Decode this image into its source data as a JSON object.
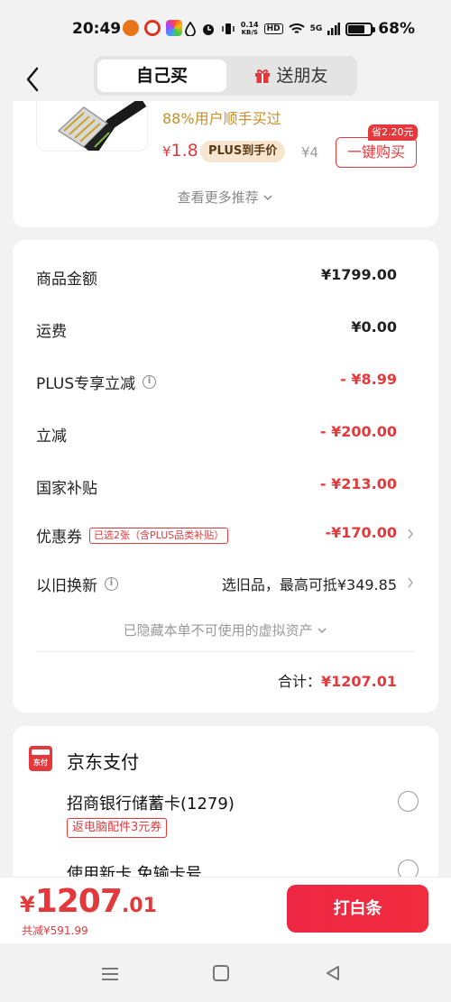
{
  "status_bar": {
    "time": "20:49",
    "net_speed_value": "0.14",
    "net_speed_unit": "KB/S",
    "hd": "HD",
    "signal": "5G",
    "battery_text": "68%",
    "battery_level": 0.68
  },
  "header": {
    "tab_self": "自己买",
    "tab_gift": "送朋友"
  },
  "recommend": {
    "tagline": "88%用户顺手买过",
    "price_symbol": "¥",
    "price": "1.8",
    "plus_label": "PLUS到手价",
    "original_price": "¥4",
    "save_tag": "省2.20元",
    "buy_button": "一键购买",
    "more_label": "查看更多推荐"
  },
  "summary": {
    "rows": [
      {
        "label": "商品金额",
        "value": "¥1799.00"
      },
      {
        "label": "运费",
        "value": "¥0.00"
      },
      {
        "label": "PLUS专享立减",
        "value": "- ¥8.99"
      },
      {
        "label": "立减",
        "value": "- ¥200.00"
      },
      {
        "label": "国家补贴",
        "value": "- ¥213.00"
      },
      {
        "label": "优惠券",
        "tag": "已选2张（含PLUS品类补贴）",
        "value": "-¥170.00"
      },
      {
        "label": "以旧换新",
        "value": "选旧品，最高可抵¥349.85"
      }
    ],
    "hidden_assets": "已隐藏本单不可使用的虚拟资产",
    "total_label": "合计：",
    "total_value": "¥1207.01"
  },
  "payment": {
    "icon_text": "东付",
    "title": "京东支付",
    "options": [
      {
        "label": "招商银行储蓄卡(1279)",
        "promo": "返电脑配件3元券"
      },
      {
        "label": "使用新卡 免输卡号"
      }
    ]
  },
  "bottom": {
    "price_symbol": "¥",
    "price_int": "1207",
    "price_dec": ".01",
    "saved": "共减¥591.99",
    "pay_button": "打白条"
  },
  "colors": {
    "accent": "#e4393c",
    "gold": "#c8902a",
    "plus_bg": "#f6e6cf"
  }
}
